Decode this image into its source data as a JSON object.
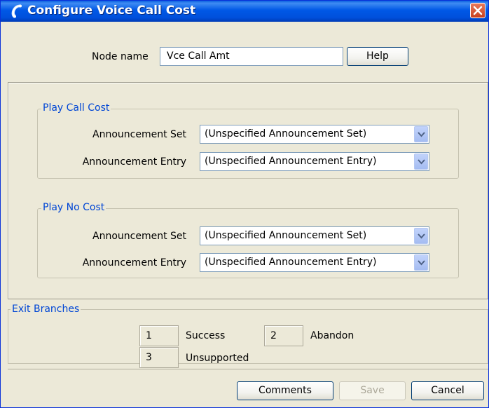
{
  "window": {
    "title": "Configure Voice Call Cost"
  },
  "node": {
    "label": "Node name",
    "value": "Vce Call Amt",
    "help_label": "Help"
  },
  "groups": [
    {
      "title": "Play Call Cost",
      "rows": [
        {
          "label": "Announcement Set",
          "value": "(Unspecified Announcement Set)"
        },
        {
          "label": "Announcement Entry",
          "value": "(Unspecified Announcement Entry)"
        }
      ]
    },
    {
      "title": "Play No Cost",
      "rows": [
        {
          "label": "Announcement Set",
          "value": "(Unspecified Announcement Set)"
        },
        {
          "label": "Announcement Entry",
          "value": "(Unspecified Announcement Entry)"
        }
      ]
    }
  ],
  "exit_branches": {
    "title": "Exit Branches",
    "items": [
      {
        "number": "1",
        "label": "Success"
      },
      {
        "number": "2",
        "label": "Abandon"
      },
      {
        "number": "3",
        "label": "Unsupported"
      }
    ]
  },
  "footer": {
    "comments_label": "Comments",
    "save_label": "Save",
    "cancel_label": "Cancel"
  },
  "icons": {
    "title_icon": "phone-handset-icon",
    "close_icon": "close-icon",
    "dropdown_icon": "chevron-down-icon"
  },
  "colors": {
    "titlebar": "#0058e6",
    "group_title": "#0046d5",
    "close_button": "#d8582f"
  }
}
